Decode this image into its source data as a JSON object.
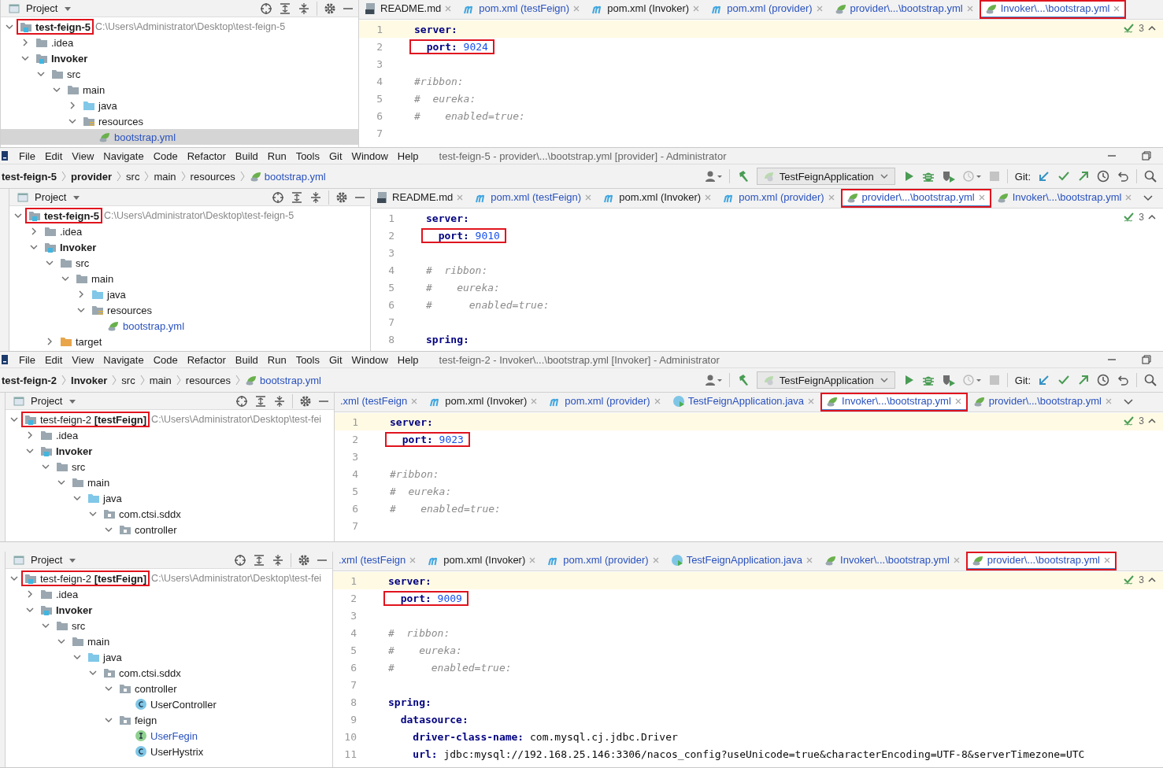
{
  "windows": [
    {
      "project": {
        "header": "Project",
        "tree": [
          {
            "label": "test-feign-5",
            "kind": "module",
            "expanded": true,
            "selected": false,
            "highlighted": true,
            "hint": "C:\\Users\\Administrator\\Desktop\\test-feign-5",
            "children": [
              {
                "label": ".idea",
                "kind": "folder",
                "expanded": false,
                "selected": false
              },
              {
                "label": "Invoker",
                "kind": "module",
                "expanded": true,
                "selected": false,
                "children": [
                  {
                    "label": "src",
                    "kind": "folder",
                    "expanded": true,
                    "selected": false,
                    "children": [
                      {
                        "label": "main",
                        "kind": "folder",
                        "expanded": true,
                        "selected": false,
                        "children": [
                          {
                            "label": "java",
                            "kind": "source",
                            "expanded": false,
                            "selected": false
                          },
                          {
                            "label": "resources",
                            "kind": "resources",
                            "expanded": true,
                            "selected": false,
                            "children": [
                              {
                                "label": "bootstrap.yml",
                                "kind": "yml",
                                "selected": true,
                                "modified": true
                              }
                            ]
                          }
                        ]
                      }
                    ]
                  }
                ]
              }
            ]
          }
        ]
      },
      "editor": {
        "tabs": [
          {
            "label": "README.md",
            "kind": "readme",
            "selected": false,
            "modified": false
          },
          {
            "label": "pom.xml (testFeign)",
            "kind": "maven",
            "selected": false,
            "modified": true
          },
          {
            "label": "pom.xml (Invoker)",
            "kind": "maven",
            "selected": false,
            "modified": false
          },
          {
            "label": "pom.xml (provider)",
            "kind": "maven",
            "selected": false,
            "modified": true
          },
          {
            "label": "provider\\...\\bootstrap.yml",
            "kind": "yml",
            "selected": false,
            "modified": true
          },
          {
            "label": "Invoker\\...\\bootstrap.yml",
            "kind": "yml",
            "selected": true,
            "modified": true,
            "highlighted": true
          }
        ],
        "inspections": "3",
        "lines": [
          {
            "number": "1",
            "kind": "key",
            "key": "server:",
            "current": true
          },
          {
            "number": "2",
            "kind": "key",
            "key": "  port:",
            "value": "9024",
            "highlighted": true
          },
          {
            "number": "3",
            "kind": "blank"
          },
          {
            "number": "4",
            "kind": "comment",
            "text": "#ribbon:"
          },
          {
            "number": "5",
            "kind": "comment",
            "text": "#  eureka:"
          },
          {
            "number": "6",
            "kind": "comment",
            "text": "#    enabled=true:"
          },
          {
            "number": "7",
            "kind": "blank"
          }
        ]
      }
    },
    {
      "menu": [
        "File",
        "Edit",
        "View",
        "Navigate",
        "Code",
        "Refactor",
        "Build",
        "Run",
        "Tools",
        "Git",
        "Window",
        "Help"
      ],
      "title": "test-feign-5 - provider\\...\\bootstrap.yml [provider] - Administrator",
      "breadcrumb": [
        {
          "label": "test-feign-5",
          "kind": "module"
        },
        {
          "label": "provider",
          "kind": "module"
        },
        {
          "label": "src",
          "kind": "folder"
        },
        {
          "label": "main",
          "kind": "folder"
        },
        {
          "label": "resources",
          "kind": "folder"
        },
        {
          "label": "bootstrap.yml",
          "kind": "yml"
        }
      ],
      "toolbar": {
        "run_config": "TestFeignApplication",
        "git_label": "Git:"
      },
      "project": {
        "header": "Project",
        "tree": [
          {
            "label": "test-feign-5",
            "kind": "module",
            "expanded": true,
            "selected": false,
            "highlighted": true,
            "hint": "C:\\Users\\Administrator\\Desktop\\test-feign-5",
            "children": [
              {
                "label": ".idea",
                "kind": "folder",
                "expanded": false,
                "selected": false
              },
              {
                "label": "Invoker",
                "kind": "module",
                "expanded": true,
                "selected": false,
                "children": [
                  {
                    "label": "src",
                    "kind": "folder",
                    "expanded": true,
                    "selected": false,
                    "children": [
                      {
                        "label": "main",
                        "kind": "folder",
                        "expanded": true,
                        "selected": false,
                        "children": [
                          {
                            "label": "java",
                            "kind": "source",
                            "expanded": false,
                            "selected": false
                          },
                          {
                            "label": "resources",
                            "kind": "resources",
                            "expanded": true,
                            "selected": false,
                            "children": [
                              {
                                "label": "bootstrap.yml",
                                "kind": "yml",
                                "selected": false,
                                "modified": true
                              }
                            ]
                          }
                        ]
                      }
                    ]
                  },
                  {
                    "label": "target",
                    "kind": "excluded",
                    "expanded": false,
                    "selected": false
                  }
                ]
              }
            ]
          }
        ]
      },
      "editor": {
        "tabs": [
          {
            "label": "README.md",
            "kind": "readme",
            "selected": false,
            "modified": false
          },
          {
            "label": "pom.xml (testFeign)",
            "kind": "maven",
            "selected": false,
            "modified": true
          },
          {
            "label": "pom.xml (Invoker)",
            "kind": "maven",
            "selected": false,
            "modified": false
          },
          {
            "label": "pom.xml (provider)",
            "kind": "maven",
            "selected": false,
            "modified": true
          },
          {
            "label": "provider\\...\\bootstrap.yml",
            "kind": "yml",
            "selected": true,
            "modified": true,
            "highlighted": true
          },
          {
            "label": "Invoker\\...\\bootstrap.yml",
            "kind": "yml",
            "selected": false,
            "modified": true
          }
        ],
        "inspections": "3",
        "lines": [
          {
            "number": "1",
            "kind": "key",
            "key": "server:"
          },
          {
            "number": "2",
            "kind": "key",
            "key": "  port:",
            "value": "9010",
            "highlighted": true
          },
          {
            "number": "3",
            "kind": "blank"
          },
          {
            "number": "4",
            "kind": "comment",
            "text": "#  ribbon:"
          },
          {
            "number": "5",
            "kind": "comment",
            "text": "#    eureka:"
          },
          {
            "number": "6",
            "kind": "comment",
            "text": "#      enabled=true:"
          },
          {
            "number": "7",
            "kind": "blank"
          },
          {
            "number": "8",
            "kind": "key",
            "key": "spring:"
          }
        ]
      }
    },
    {
      "menu": [
        "File",
        "Edit",
        "View",
        "Navigate",
        "Code",
        "Refactor",
        "Build",
        "Run",
        "Tools",
        "Git",
        "Window",
        "Help"
      ],
      "title": "test-feign-2 - Invoker\\...\\bootstrap.yml [Invoker] - Administrator",
      "breadcrumb": [
        {
          "label": "test-feign-2",
          "kind": "module"
        },
        {
          "label": "Invoker",
          "kind": "module"
        },
        {
          "label": "src",
          "kind": "folder"
        },
        {
          "label": "main",
          "kind": "folder"
        },
        {
          "label": "resources",
          "kind": "folder"
        },
        {
          "label": "bootstrap.yml",
          "kind": "yml"
        }
      ],
      "toolbar": {
        "run_config": "TestFeignApplication",
        "git_label": "Git:"
      },
      "project": {
        "header": "Project",
        "tree": [
          {
            "label": "test-feign-2 **[testFeign]**",
            "kind": "root",
            "expanded": true,
            "selected": false,
            "highlighted": true,
            "hint": "C:\\Users\\Administrator\\Desktop\\test-fei",
            "children": [
              {
                "label": ".idea",
                "kind": "folder",
                "expanded": false,
                "selected": false
              },
              {
                "label": "Invoker",
                "kind": "module",
                "expanded": true,
                "selected": false,
                "children": [
                  {
                    "label": "src",
                    "kind": "folder",
                    "expanded": true,
                    "selected": false,
                    "children": [
                      {
                        "label": "main",
                        "kind": "folder",
                        "expanded": true,
                        "selected": false,
                        "children": [
                          {
                            "label": "java",
                            "kind": "source",
                            "expanded": true,
                            "selected": false,
                            "children": [
                              {
                                "label": "com.ctsi.sddx",
                                "kind": "package",
                                "expanded": true,
                                "selected": false,
                                "children": [
                                  {
                                    "label": "controller",
                                    "kind": "package",
                                    "expanded": true,
                                    "selected": false
                                  }
                                ]
                              }
                            ]
                          }
                        ]
                      }
                    ]
                  }
                ]
              }
            ]
          }
        ]
      },
      "editor": {
        "tabs": [
          {
            "label": ".xml (testFeign",
            "kind": "partial",
            "selected": false,
            "modified": true
          },
          {
            "label": "pom.xml (Invoker)",
            "kind": "maven",
            "selected": false,
            "modified": false
          },
          {
            "label": "pom.xml (provider)",
            "kind": "maven",
            "selected": false,
            "modified": true
          },
          {
            "label": "TestFeignApplication.java",
            "kind": "java",
            "selected": false,
            "modified": true
          },
          {
            "label": "Invoker\\...\\bootstrap.yml",
            "kind": "yml",
            "selected": true,
            "modified": true,
            "highlighted": true
          },
          {
            "label": "provider\\...\\bootstrap.yml",
            "kind": "yml",
            "selected": false,
            "modified": true
          }
        ],
        "inspections": "3",
        "lines": [
          {
            "number": "1",
            "kind": "key",
            "key": "server:",
            "current": true
          },
          {
            "number": "2",
            "kind": "key",
            "key": "  port:",
            "value": "9023",
            "highlighted": true
          },
          {
            "number": "3",
            "kind": "blank"
          },
          {
            "number": "4",
            "kind": "comment",
            "text": "#ribbon:"
          },
          {
            "number": "5",
            "kind": "comment",
            "text": "#  eureka:"
          },
          {
            "number": "6",
            "kind": "comment",
            "text": "#    enabled=true:"
          },
          {
            "number": "7",
            "kind": "blank"
          }
        ]
      }
    },
    {
      "project": {
        "header": "Project",
        "tree": [
          {
            "label": "test-feign-2 **[testFeign]**",
            "kind": "root",
            "expanded": true,
            "selected": false,
            "highlighted": true,
            "hint": "C:\\Users\\Administrator\\Desktop\\test-fei",
            "children": [
              {
                "label": ".idea",
                "kind": "folder",
                "expanded": false,
                "selected": false
              },
              {
                "label": "Invoker",
                "kind": "module",
                "expanded": true,
                "selected": false,
                "children": [
                  {
                    "label": "src",
                    "kind": "folder",
                    "expanded": true,
                    "selected": false,
                    "children": [
                      {
                        "label": "main",
                        "kind": "folder",
                        "expanded": true,
                        "selected": false,
                        "children": [
                          {
                            "label": "java",
                            "kind": "source",
                            "expanded": true,
                            "selected": false,
                            "children": [
                              {
                                "label": "com.ctsi.sddx",
                                "kind": "package",
                                "expanded": true,
                                "selected": false,
                                "children": [
                                  {
                                    "label": "controller",
                                    "kind": "package",
                                    "expanded": true,
                                    "selected": false,
                                    "children": [
                                      {
                                        "label": "UserController",
                                        "kind": "class",
                                        "selected": false
                                      }
                                    ]
                                  },
                                  {
                                    "label": "feign",
                                    "kind": "package",
                                    "expanded": true,
                                    "selected": false,
                                    "children": [
                                      {
                                        "label": "UserFegin",
                                        "kind": "interface",
                                        "selected": false,
                                        "modified": true
                                      },
                                      {
                                        "label": "UserHystrix",
                                        "kind": "class",
                                        "selected": false
                                      }
                                    ]
                                  }
                                ]
                              }
                            ]
                          }
                        ]
                      }
                    ]
                  }
                ]
              }
            ]
          }
        ]
      },
      "editor": {
        "tabs": [
          {
            "label": ".xml (testFeign",
            "kind": "partial",
            "selected": false,
            "modified": true
          },
          {
            "label": "pom.xml (Invoker)",
            "kind": "maven",
            "selected": false,
            "modified": false
          },
          {
            "label": "pom.xml (provider)",
            "kind": "maven",
            "selected": false,
            "modified": true
          },
          {
            "label": "TestFeignApplication.java",
            "kind": "java",
            "selected": false,
            "modified": true
          },
          {
            "label": "Invoker\\...\\bootstrap.yml",
            "kind": "yml",
            "selected": false,
            "modified": true
          },
          {
            "label": "provider\\...\\bootstrap.yml",
            "kind": "yml",
            "selected": true,
            "modified": true,
            "highlighted": true
          }
        ],
        "inspections": "3",
        "lines": [
          {
            "number": "1",
            "kind": "key",
            "key": "server:",
            "current": true
          },
          {
            "number": "2",
            "kind": "key",
            "key": "  port:",
            "value": "9009",
            "highlighted": true
          },
          {
            "number": "3",
            "kind": "blank"
          },
          {
            "number": "4",
            "kind": "comment",
            "text": "#  ribbon:"
          },
          {
            "number": "5",
            "kind": "comment",
            "text": "#    eureka:"
          },
          {
            "number": "6",
            "kind": "comment",
            "text": "#      enabled=true:"
          },
          {
            "number": "7",
            "kind": "blank"
          },
          {
            "number": "8",
            "kind": "key",
            "key": "spring:"
          },
          {
            "number": "9",
            "kind": "key",
            "key": "  datasource:"
          },
          {
            "number": "10",
            "kind": "setting",
            "key": "    driver-class-name:",
            "value": "com.mysql.cj.jdbc.Driver"
          },
          {
            "number": "11",
            "kind": "setting",
            "key": "    url:",
            "value": "jdbc:mysql://192.168.25.146:3306/nacos_config?useUnicode=true&characterEncoding=UTF-8&serverTimezone=UTC"
          }
        ]
      }
    }
  ]
}
